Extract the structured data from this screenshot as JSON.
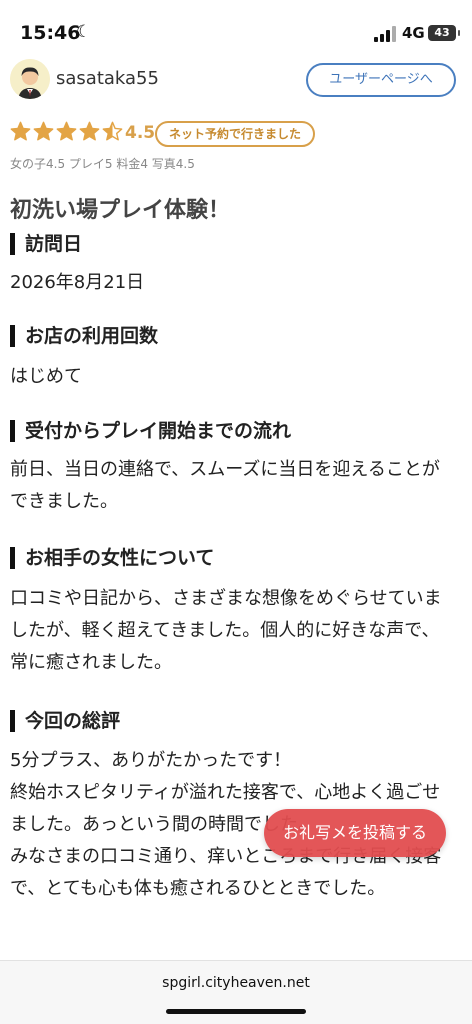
{
  "status_bar": {
    "time": "15:46",
    "network": "4G",
    "battery": "43"
  },
  "user": {
    "name": "sasataka55",
    "page_button": "ユーザーページへ"
  },
  "rating": {
    "stars_value": 4.5,
    "score": "4.5",
    "badge": "ネット予約で行きました",
    "subscores": "女の子4.5 プレイ5 料金4 写真4.5",
    "star_color": "#e3a445"
  },
  "review": {
    "title": "初洗い場プレイ体験！",
    "sections": [
      {
        "heading": "訪問日",
        "body": "2026年8月21日"
      },
      {
        "heading": "お店の利用回数",
        "body": "はじめて"
      },
      {
        "heading": "受付からプレイ開始までの流れ",
        "body": "前日、当日の連絡で、スムーズに当日を迎えることができました。"
      },
      {
        "heading": "お相手の女性について",
        "body": "口コミや日記から、さまざまな想像をめぐらせていましたが、軽く超えてきました。個人的に好きな声で、常に癒されました。"
      },
      {
        "heading": "今回の総評",
        "body": "5分プラス、ありがたかったです！\n終始ホスピタリティが溢れた接客で、心地よく過ごせました。あっという間の時間でした。\nみなさまの口コミ通り、痒いところまで行き届く接客で、とても心も体も癒されるひとときでした。"
      }
    ]
  },
  "floating_button": {
    "label": "お礼写メを投稿する",
    "color": "#e24d4f"
  },
  "browser": {
    "url": "spgirl.cityheaven.net"
  }
}
